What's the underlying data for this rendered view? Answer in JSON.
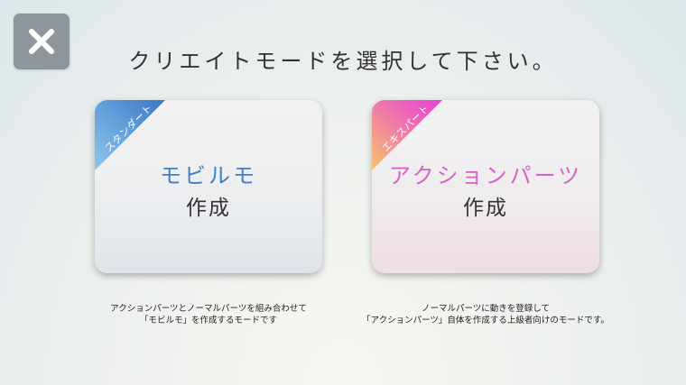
{
  "header": {
    "title": "クリエイトモードを選択して下さい。"
  },
  "close_button": {
    "icon": "close-icon"
  },
  "cards": {
    "standard": {
      "ribbon": "スタンダート",
      "name": "モビルモ",
      "action": "作成",
      "description_line1": "アクションパーツとノーマルパーツを組み合わせて",
      "description_line2": "「モビルモ」を作成するモードです"
    },
    "expert": {
      "ribbon": "エキスパート",
      "name": "アクションパーツ",
      "action": "作成",
      "description_line1": "ノーマルパーツに動きを登録して",
      "description_line2": "「アクションパーツ」自体を作成する上級者向けのモードです。"
    }
  },
  "colors": {
    "standard_accent": "#3f7fc6",
    "expert_accent": "#d463c6",
    "close_button_bg": "#8e959c"
  }
}
